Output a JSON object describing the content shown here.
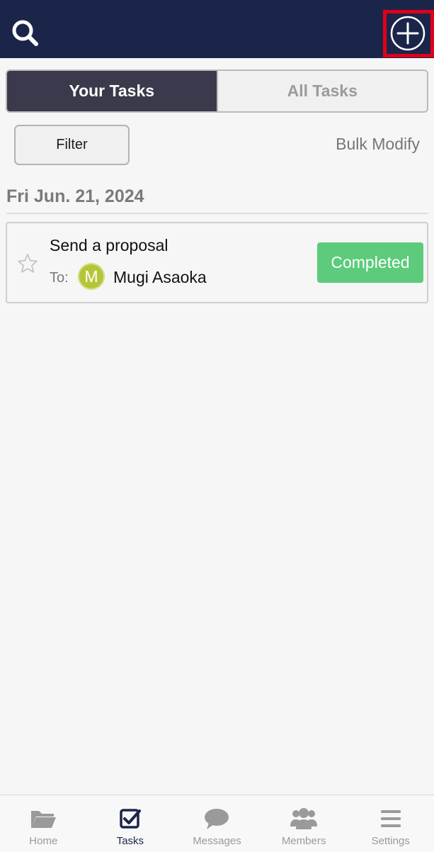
{
  "header": {
    "search_icon": "search-icon",
    "add_icon": "plus-circle-icon",
    "highlight_color": "#e0001a",
    "bar_color": "#1b254a"
  },
  "segmented": {
    "your_tasks": "Your Tasks",
    "all_tasks": "All Tasks",
    "active": "Your Tasks"
  },
  "toolbar": {
    "filter_label": "Filter",
    "bulk_modify_label": "Bulk Modify"
  },
  "groups": [
    {
      "date": "Fri Jun. 21, 2024",
      "tasks": [
        {
          "title": "Send a proposal",
          "to_label": "To:",
          "assignee_initial": "M",
          "assignee_name": "Mugi Asaoka",
          "status": "Completed",
          "status_color": "#5ccb7b",
          "starred": false
        }
      ]
    }
  ],
  "tabbar": {
    "items": [
      {
        "label": "Home",
        "icon": "folder-icon"
      },
      {
        "label": "Tasks",
        "icon": "checkbox-icon"
      },
      {
        "label": "Messages",
        "icon": "speech-bubble-icon"
      },
      {
        "label": "Members",
        "icon": "members-icon"
      },
      {
        "label": "Settings",
        "icon": "menu-icon"
      }
    ],
    "active": "Tasks"
  }
}
